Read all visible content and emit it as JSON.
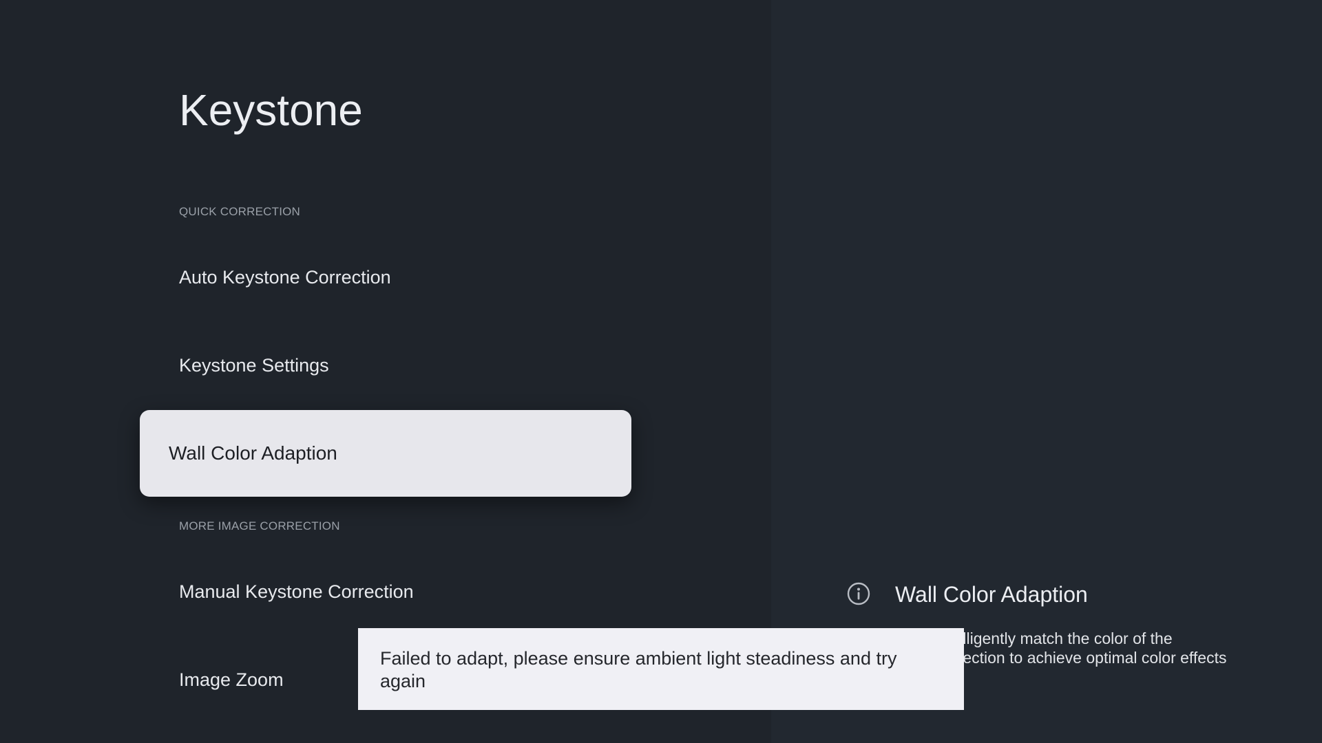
{
  "page": {
    "title": "Keystone"
  },
  "sections": {
    "quick_correction": "QUICK CORRECTION",
    "more_image_correction": "MORE IMAGE CORRECTION"
  },
  "menu": {
    "auto_keystone": "Auto Keystone Correction",
    "keystone_settings": "Keystone Settings",
    "wall_color_adaption": "Wall Color Adaption",
    "manual_keystone": "Manual Keystone Correction",
    "image_zoom": "Image Zoom",
    "focused_item": "Wall Color Adaption"
  },
  "info": {
    "icon": "info-circle-icon",
    "title": "Wall Color Adaption",
    "description": "Intelligently match the color of the projection to achieve optimal color effects"
  },
  "toast": {
    "message": "Failed to adapt, please ensure ambient light steadiness and try again"
  },
  "colors": {
    "background": "#1f242b",
    "focused_item_bg": "#e7e7ec",
    "toast_bg": "#f0f0f5",
    "text_primary": "#eceef2",
    "text_secondary": "#9aa0a8"
  }
}
